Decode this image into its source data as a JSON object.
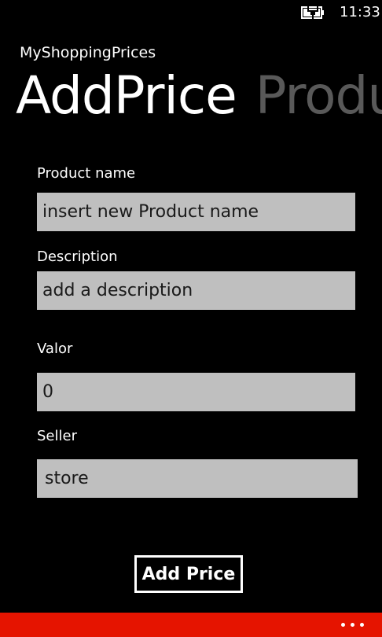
{
  "status_bar": {
    "time": "11:33",
    "battery_icon": "battery-charging-icon"
  },
  "app": {
    "title": "MyShoppingPrices"
  },
  "pivot": {
    "items": [
      "AddPrice",
      "Produ"
    ],
    "active_index": 0
  },
  "form": {
    "product_name": {
      "label": "Product name",
      "value": "insert new Product name"
    },
    "description": {
      "label": "Description",
      "value": "add a description"
    },
    "valor": {
      "label": "Valor",
      "value": "0"
    },
    "seller": {
      "label": "Seller",
      "value": "store"
    }
  },
  "actions": {
    "add_price_label": "Add Price"
  },
  "app_bar": {
    "more_icon": "ellipsis-icon"
  },
  "colors": {
    "background": "#000000",
    "input_background": "#bfbfbf",
    "accent": "#e51400",
    "inactive_pivot": "#595959"
  }
}
